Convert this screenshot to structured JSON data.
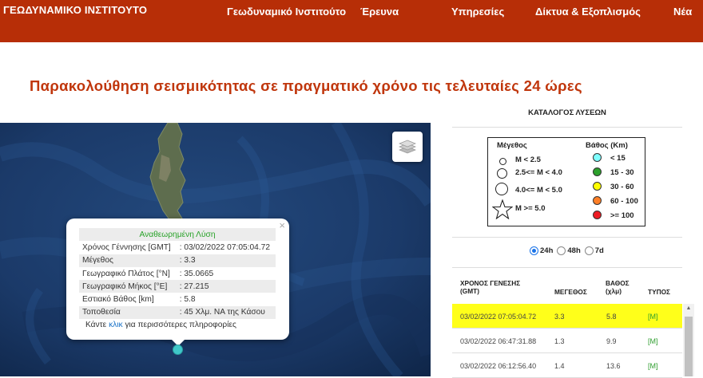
{
  "header": {
    "logo": "ΓΕΩΔΥΝΑΜΙΚΟ ΙΝΣΤΙΤΟΥΤΟ",
    "nav": [
      "Γεωδυναμικό Ινστιτούτο",
      "Έρευνα",
      "Υπηρεσίες",
      "Δίκτυα & Εξοπλισμός",
      "Νέα"
    ],
    "bg_color": "#b72e07"
  },
  "page_title": "Παρακολούθηση σεισμικότητας σε πραγματικό χρόνο τις τελευταίες 24 ώρες",
  "map": {
    "layers_icon": "layers-icon",
    "popup": {
      "header": "Αναθεωρημένη Λύση",
      "close": "×",
      "rows": [
        {
          "label": "Χρόνος Γέννησης [GMT]",
          "value": ": 03/02/2022 07:05:04.72"
        },
        {
          "label": "Μέγεθος",
          "value": ": 3.3"
        },
        {
          "label": "Γεωγραφικό Πλάτος [°N]",
          "value": ": 35.0665"
        },
        {
          "label": "Γεωγραφικό Μήκος [°E]",
          "value": ": 27.215"
        },
        {
          "label": "Εστιακό Βάθος [km]",
          "value": ": 5.8"
        },
        {
          "label": "Τοποθεσία",
          "value": ": 45 Χλμ. ΝΑ της Κάσου"
        }
      ],
      "more_prefix": "Κάντε ",
      "more_link": "κλικ",
      "more_suffix": " για περισσότερες πληροφορίες"
    },
    "marker_color": "#3fc7c9"
  },
  "panel": {
    "title": "ΚΑΤΑΛΟΓΟΣ ΛΥΣΕΩΝ",
    "legend": {
      "magnitude_title": "Μέγεθος",
      "depth_title": "Βάθος (Km)",
      "magnitudes": [
        "M < 2.5",
        "2.5<= M < 4.0",
        "4.0<= M < 5.0",
        "M >= 5.0"
      ],
      "depths": [
        {
          "label": "< 15",
          "color": "#7fffff"
        },
        {
          "label": "15 - 30",
          "color": "#2ca02c"
        },
        {
          "label": "30 - 60",
          "color": "#ffff00"
        },
        {
          "label": "60 - 100",
          "color": "#ff7f27"
        },
        {
          "label": ">= 100",
          "color": "#ed1c24"
        }
      ]
    },
    "periods": [
      {
        "label": "24h",
        "selected": true
      },
      {
        "label": "48h",
        "selected": false
      },
      {
        "label": "7d",
        "selected": false
      }
    ],
    "table": {
      "headers": {
        "time": "ΧΡΟΝΟΣ ΓΕΝΕΣΗΣ (GMT)",
        "magnitude": "ΜΕΓΕΘΟΣ",
        "depth": "ΒΑΘΟΣ (χλμ)",
        "type": "ΤΥΠΟΣ"
      },
      "rows": [
        {
          "time": "03/02/2022 07:05:04.72",
          "magnitude": "3.3",
          "depth": "5.8",
          "type": "[M]",
          "selected": true
        },
        {
          "time": "03/02/2022 06:47:31.88",
          "magnitude": "1.3",
          "depth": "9.9",
          "type": "[M]",
          "selected": false
        },
        {
          "time": "03/02/2022 06:12:56.40",
          "magnitude": "1.4",
          "depth": "13.6",
          "type": "[M]",
          "selected": false
        }
      ]
    }
  }
}
